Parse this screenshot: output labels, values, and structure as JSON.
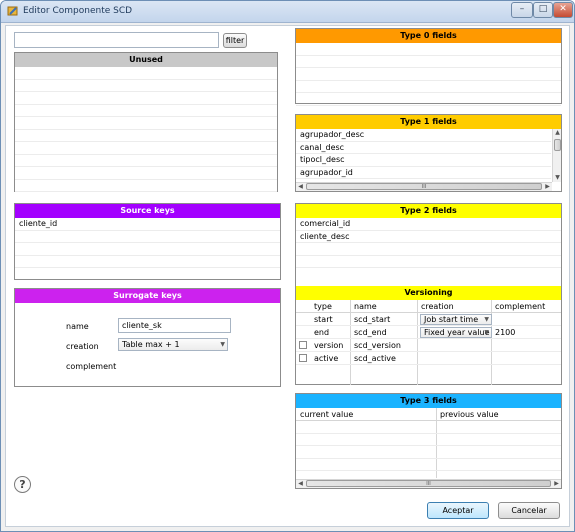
{
  "window": {
    "title": "Editor Componente SCD",
    "controls": {
      "minimize": "–",
      "maximize": "□",
      "close": "✕"
    }
  },
  "left": {
    "filter_input": {
      "value": "",
      "placeholder": ""
    },
    "filter_button": "filter",
    "unused": {
      "title": "Unused",
      "items": []
    },
    "source_keys": {
      "title": "Source keys",
      "items": [
        "cliente_id"
      ]
    },
    "surrogate_keys": {
      "title": "Surrogate keys",
      "name_label": "name",
      "name_value": "cliente_sk",
      "creation_label": "creation",
      "creation_value": "Table max + 1",
      "complement_label": "complement"
    }
  },
  "right": {
    "type0": {
      "title": "Type 0 fields",
      "items": []
    },
    "type1": {
      "title": "Type 1 fields",
      "items": [
        "agrupador_desc",
        "canal_desc",
        "tipocl_desc",
        "agrupador_id"
      ],
      "hscroll_label": "III"
    },
    "type2": {
      "title": "Type 2 fields",
      "items": [
        "comercial_id",
        "cliente_desc"
      ]
    },
    "versioning": {
      "title": "Versioning",
      "columns": [
        "type",
        "name",
        "creation",
        "complement"
      ],
      "rows": [
        {
          "type": "start",
          "name": "scd_start",
          "creation": "Job start time",
          "complement": "",
          "has_checkbox": false,
          "has_combo": true
        },
        {
          "type": "end",
          "name": "scd_end",
          "creation": "Fixed year value",
          "complement": "2100",
          "has_checkbox": false,
          "has_combo": true
        },
        {
          "type": "version",
          "name": "scd_version",
          "creation": "",
          "complement": "",
          "has_checkbox": true,
          "has_combo": false
        },
        {
          "type": "active",
          "name": "scd_active",
          "creation": "",
          "complement": "",
          "has_checkbox": true,
          "has_combo": false
        }
      ]
    },
    "type3": {
      "title": "Type 3 fields",
      "columns": [
        "current value",
        "previous value"
      ],
      "hscroll_label": "III"
    }
  },
  "footer": {
    "help_icon": "?",
    "accept_button": "Aceptar",
    "cancel_button": "Cancelar"
  },
  "colors": {
    "unused_header": "#c8c8c8",
    "source_header": "#a300ff",
    "surrogate_header": "#cc22ee",
    "type0_header": "#ff9900",
    "type1_header": "#ffcc00",
    "type2_header": "#ffff00",
    "versioning_header": "#ffff00",
    "type3_header": "#1ab3ff"
  }
}
